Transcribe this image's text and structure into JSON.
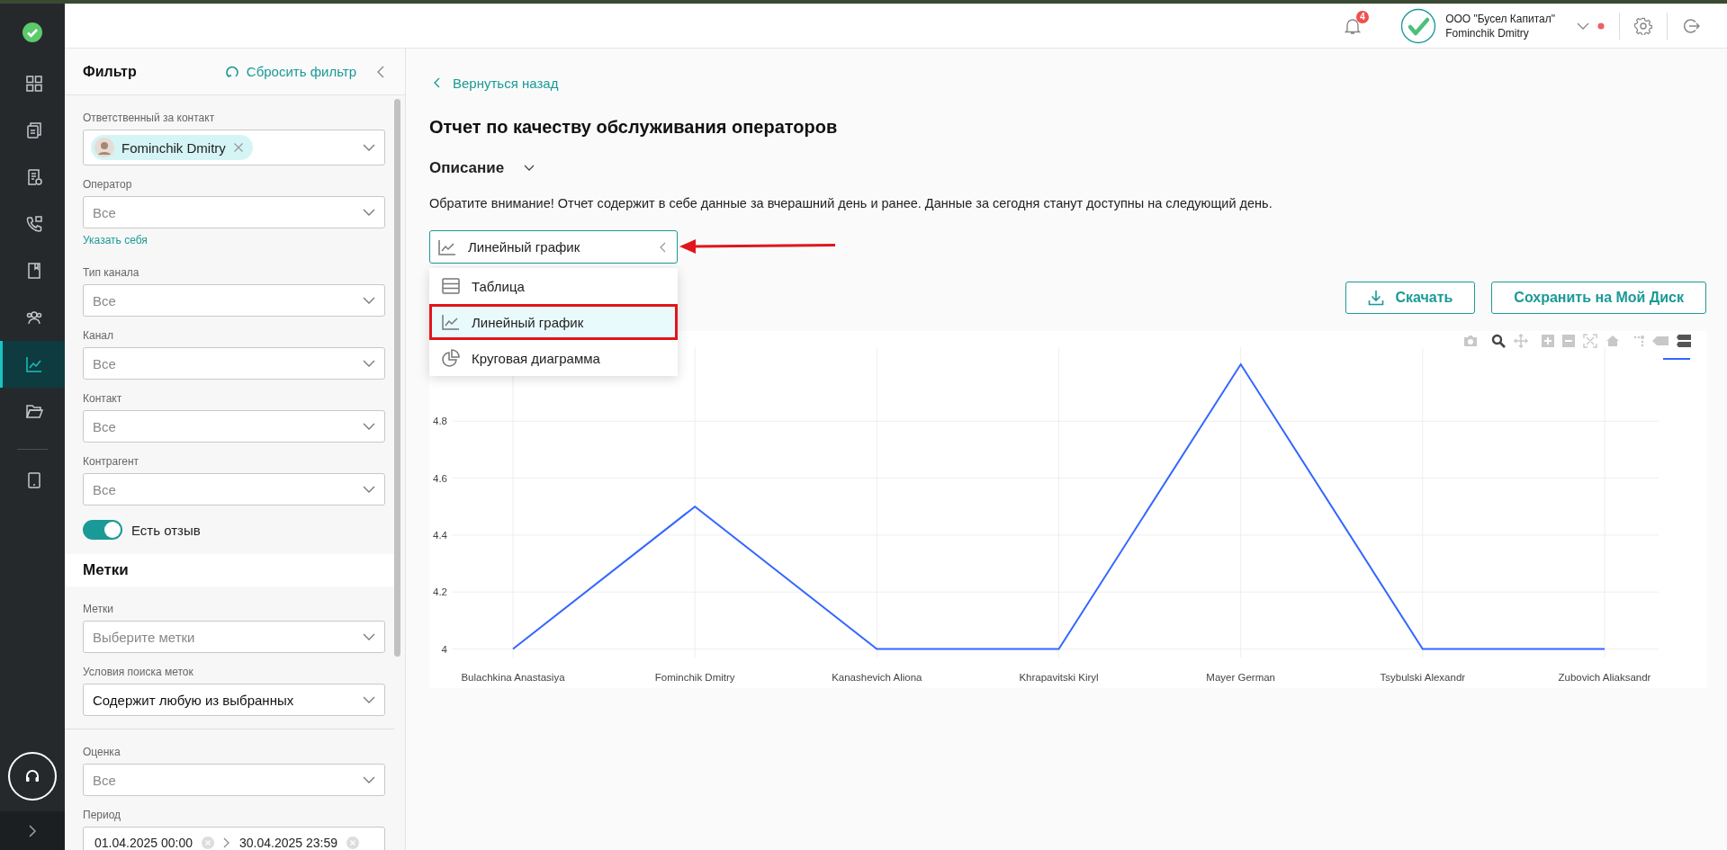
{
  "rail": {
    "items": [
      {
        "kind": "dashboard",
        "selected": false
      },
      {
        "kind": "clipboard",
        "selected": false
      },
      {
        "kind": "report",
        "selected": false
      },
      {
        "kind": "phone",
        "selected": false
      },
      {
        "kind": "book",
        "selected": false
      },
      {
        "kind": "users",
        "selected": false
      },
      {
        "kind": "chart",
        "selected": true
      },
      {
        "kind": "folder",
        "selected": false
      }
    ],
    "bottom_items": [
      {
        "kind": "tablet",
        "selected": false
      }
    ]
  },
  "header": {
    "notifications": "4",
    "company": "ООО \"Бусел Капитал\"",
    "user": "Fominchik Dmitry"
  },
  "filter": {
    "title": "Фильтр",
    "reset": "Сбросить фильтр",
    "items": [
      {
        "kind": "chip",
        "label": "Ответственный за контакт",
        "value": "Fominchik Dmitry"
      },
      {
        "kind": "select",
        "label": "Оператор",
        "placeholder": "Все",
        "link": "Указать себя"
      },
      {
        "kind": "select",
        "label": "Тип канала",
        "placeholder": "Все"
      },
      {
        "kind": "select",
        "label": "Канал",
        "placeholder": "Все"
      },
      {
        "kind": "select",
        "label": "Контакт",
        "placeholder": "Все"
      },
      {
        "kind": "select",
        "label": "Контрагент",
        "placeholder": "Все"
      },
      {
        "kind": "toggle",
        "label": "Есть отзыв",
        "on": true
      },
      {
        "kind": "section",
        "label": "Метки"
      },
      {
        "kind": "select",
        "label": "Метки",
        "placeholder": "Выберите метки"
      },
      {
        "kind": "select",
        "label": "Условия поиска меток",
        "value": "Содержит любую из выбранных"
      },
      {
        "kind": "divider"
      },
      {
        "kind": "select",
        "label": "Оценка",
        "placeholder": "Все"
      },
      {
        "kind": "daterange",
        "label": "Период",
        "from": "01.04.2025 00:00",
        "to": "30.04.2025 23:59"
      }
    ]
  },
  "main": {
    "back": "Вернуться назад",
    "title": "Отчет по качеству обслуживания операторов",
    "description": {
      "label": "Описание",
      "expanded": false
    },
    "notice": "Обратите внимание! Отчет содержит в себе данные за вчерашний день и ранее. Данные за сегодня станут доступны на следующий день.",
    "view_select": {
      "value": "Линейный график",
      "kind": "line",
      "open": true,
      "options": [
        {
          "label": "Таблица",
          "kind": "table",
          "selected": false,
          "highlighted": false
        },
        {
          "label": "Линейный график",
          "kind": "line",
          "selected": true,
          "highlighted": true
        },
        {
          "label": "Круговая диаграмма",
          "kind": "pie",
          "selected": false,
          "highlighted": false
        }
      ]
    },
    "actions": [
      {
        "label": "Скачать",
        "kind": "download"
      },
      {
        "label": "Сохранить на Мой Диск",
        "kind": "plain"
      }
    ],
    "chart_data": {
      "type": "line",
      "categories": [
        "Bulachkina Anastasiya",
        "Fominchik Dmitry",
        "Kanashevich Aliona",
        "Khrapavitski Kiryl",
        "Mayer German",
        "Tsybulski Alexandr",
        "Zubovich Aliaksandr"
      ],
      "series": [
        {
          "color": "#3366ff",
          "values": [
            4,
            4.5,
            4,
            4,
            5,
            4,
            4
          ]
        }
      ],
      "grid": true,
      "ylim": [
        3.97,
        5.06
      ],
      "yticks": [
        4,
        4.2,
        4.4,
        4.6,
        4.8
      ]
    }
  }
}
